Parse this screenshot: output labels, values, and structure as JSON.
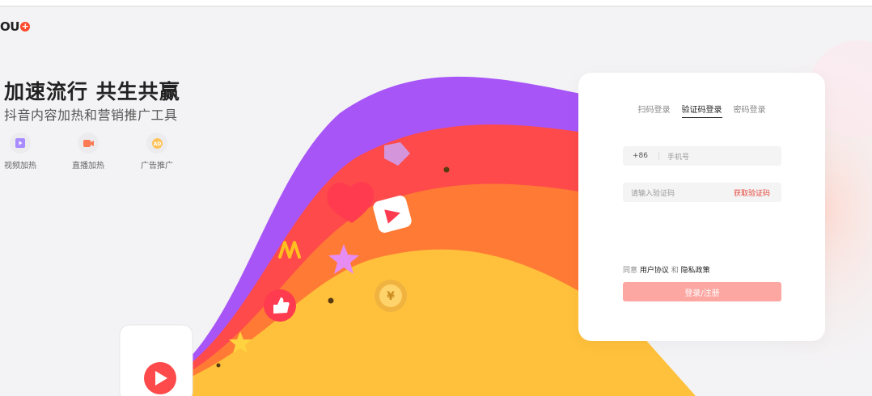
{
  "brand": {
    "logo_text": "OU",
    "logo_mark": "+"
  },
  "hero": {
    "headline": "加速流行 共生共赢",
    "subtitle": "抖音内容加热和营销推广工具"
  },
  "features": [
    {
      "label": "视频加热",
      "icon": "video-play-icon",
      "color": "#8c6cff"
    },
    {
      "label": "直播加热",
      "icon": "live-camera-icon",
      "color": "#fe6b4a"
    },
    {
      "label": "广告推广",
      "icon": "ad-icon",
      "color": "#ffb545"
    }
  ],
  "login": {
    "tabs": [
      "扫码登录",
      "验证码登录",
      "密码登录"
    ],
    "active_tab": "验证码登录",
    "country_code": "+86",
    "phone_placeholder": "手机号",
    "code_placeholder": "请输入验证码",
    "send_code_label": "获取验证码",
    "agree_prefix": "同意",
    "user_agreement": "用户协议",
    "agree_and": "和",
    "privacy_policy": "隐私政策",
    "submit_label": "登录/注册"
  },
  "colors": {
    "accent": "#fe2c55",
    "button": "#fca7a2",
    "ribbon_purple": "#a855f7",
    "ribbon_red": "#fe4a4a",
    "ribbon_orange": "#ff7a35",
    "ribbon_yellow": "#ffc13b"
  }
}
